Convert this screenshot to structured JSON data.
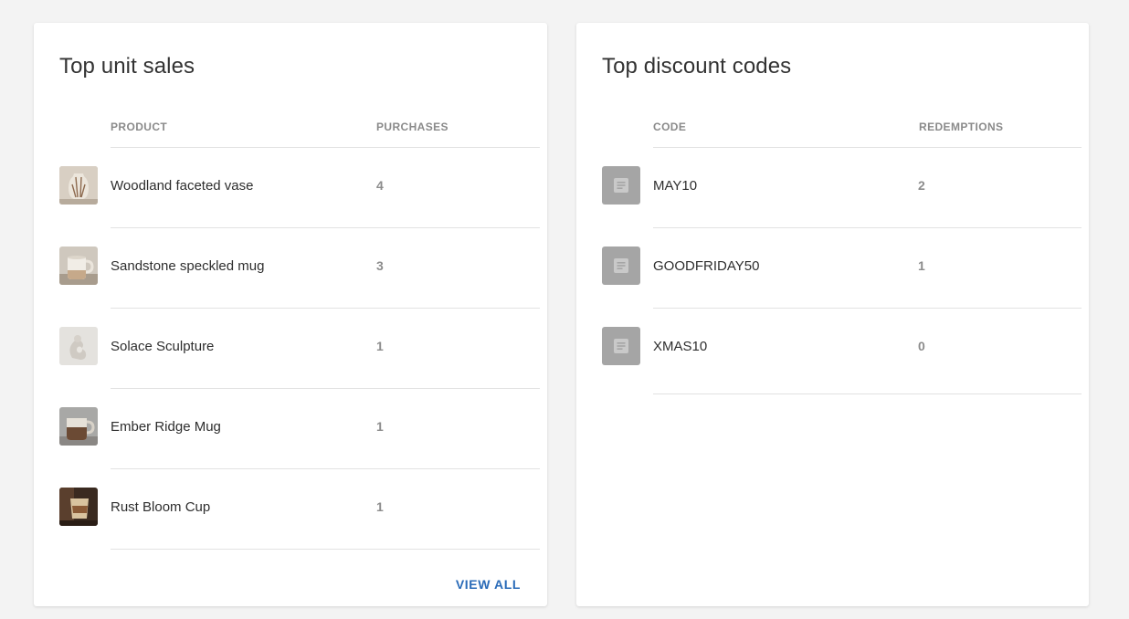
{
  "top_unit_sales": {
    "title": "Top unit sales",
    "columns": [
      "PRODUCT",
      "PURCHASES"
    ],
    "rows": [
      {
        "product": "Woodland faceted vase",
        "purchases": "4",
        "thumb_icon": "vase-photo-icon"
      },
      {
        "product": "Sandstone speckled mug",
        "purchases": "3",
        "thumb_icon": "mug-photo-icon"
      },
      {
        "product": "Solace Sculpture",
        "purchases": "1",
        "thumb_icon": "sculpture-photo-icon"
      },
      {
        "product": "Ember Ridge Mug",
        "purchases": "1",
        "thumb_icon": "mug-photo-icon"
      },
      {
        "product": "Rust Bloom Cup",
        "purchases": "1",
        "thumb_icon": "cup-photo-icon"
      }
    ],
    "view_all_label": "VIEW ALL"
  },
  "top_discount_codes": {
    "title": "Top discount codes",
    "columns": [
      "CODE",
      "REDEMPTIONS"
    ],
    "rows": [
      {
        "code": "MAY10",
        "redemptions": "2",
        "icon": "document-icon"
      },
      {
        "code": "GOODFRIDAY50",
        "redemptions": "1",
        "icon": "document-icon"
      },
      {
        "code": "XMAS10",
        "redemptions": "0",
        "icon": "document-icon"
      }
    ]
  },
  "colors": {
    "background": "#f3f3f3",
    "card": "#ffffff",
    "link": "#2a6bb8",
    "muted_text": "#8a8a8a",
    "divider": "#e2e2e2",
    "code_icon_bg": "#a5a5a5"
  }
}
